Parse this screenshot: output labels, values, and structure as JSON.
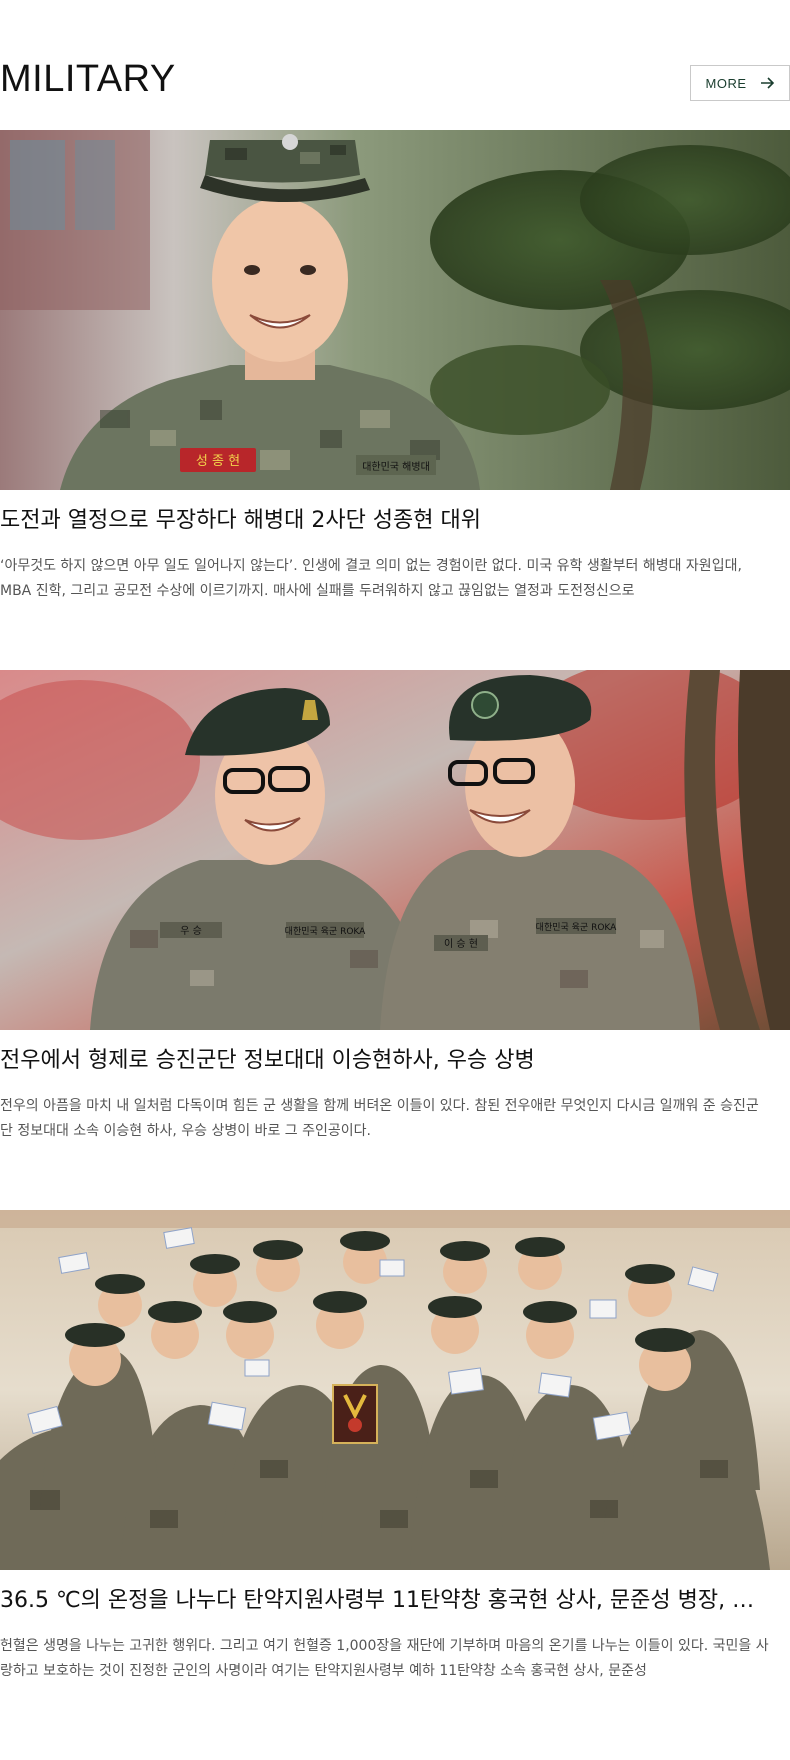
{
  "section": {
    "title": "MILITARY",
    "more_label": "MORE"
  },
  "colors": {
    "accent": "#1a3d2e",
    "title_text": "#111111",
    "excerpt_text": "#555555",
    "border": "#c9c9c9"
  },
  "articles": [
    {
      "title": "도전과 열정으로 무장하다 해병대 2사단  성종현 대위",
      "excerpt": "‘아무것도 하지 않으면 아무 일도 일어나지 않는다’. 인생에 결코 의미 없는 경험이란 없다. 미국 유학 생활부터 해병대 자원입대, MBA 진학, 그리고 공모전 수상에 이르기까지. 매사에 실패를 두려워하지 않고 끊임없는 열정과 도전정신으로",
      "image_alt": "Marine captain smiling in camouflage uniform",
      "name_tag": "성 종 현",
      "unit_tag": "대한민국 해병대"
    },
    {
      "title": "전우에서 형제로 승진군단 정보대대 이승현하사, 우승 상병",
      "excerpt": "전우의 아픔을 마치 내 일처럼 다독이며 힘든 군 생활을 함께 버텨온 이들이 있다. 참된 전우애란 무엇인지 다시금 일깨워 준 승진군단 정보대대 소속 이승현 하사, 우승 상병이 바로 그 주인공이다.",
      "image_alt": "Two soldiers in berets smiling at each other",
      "name_tag_left": "우 승",
      "name_tag_right": "이 승 현",
      "unit_tag": "대한민국 육군 ROKA"
    },
    {
      "title": "36.5 ℃의 온정을 나누다 탄약지원사령부 11탄약창  홍국현 상사, 문준성 병장, …",
      "excerpt": "헌혈은 생명을 나누는 고귀한 행위다. 그리고 여기 헌혈증 1,000장을 재단에 기부하며 마음의 온기를 나누는 이들이 있다. 국민을 사랑하고 보호하는 것이 진정한 군인의 사명이라 여기는 탄약지원사령부 예하 11탄약창 소속 홍국현 상사, 문준성",
      "image_alt": "Group of soldiers holding blood donation certificates"
    }
  ]
}
